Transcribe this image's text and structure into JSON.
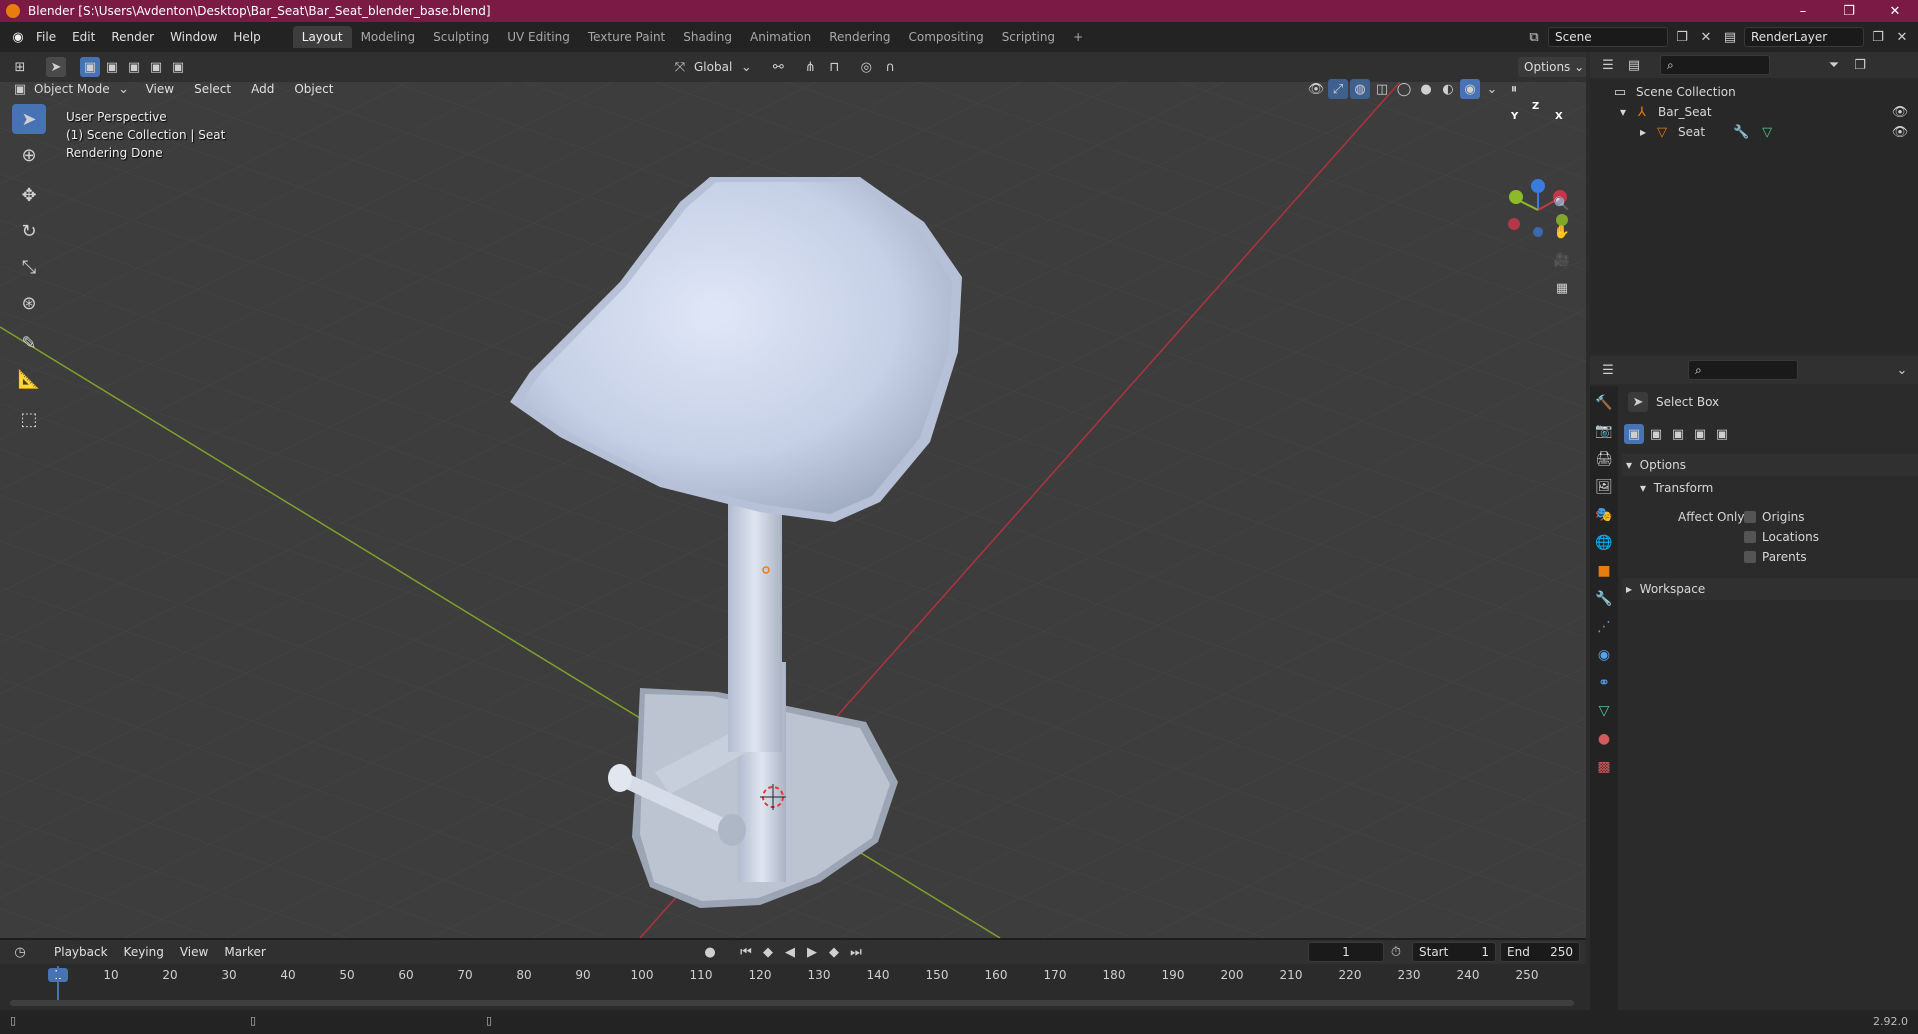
{
  "window": {
    "title": "Blender [S:\\Users\\Avdenton\\Desktop\\Bar_Seat\\Bar_Seat_blender_base.blend]",
    "controls": [
      "–",
      "❐",
      "✕"
    ]
  },
  "menubar": {
    "items": [
      "File",
      "Edit",
      "Render",
      "Window",
      "Help"
    ],
    "workspaces": [
      "Layout",
      "Modeling",
      "Sculpting",
      "UV Editing",
      "Texture Paint",
      "Shading",
      "Animation",
      "Rendering",
      "Compositing",
      "Scripting"
    ],
    "active_workspace": "Layout",
    "add_tab": "+",
    "scene": "Scene",
    "view_layer": "RenderLayer"
  },
  "tool_header": {
    "orientation": "Global",
    "options_label": "Options"
  },
  "viewport_header": {
    "mode": "Object Mode",
    "menus": [
      "View",
      "Select",
      "Add",
      "Object"
    ]
  },
  "viewport": {
    "overlay_lines": [
      "User Perspective",
      "(1) Scene Collection | Seat",
      "Rendering Done"
    ],
    "gizmo": {
      "x": "X",
      "y": "Y",
      "z": "Z"
    }
  },
  "outliner": {
    "root": "Scene Collection",
    "items": [
      {
        "label": "Bar_Seat",
        "depth": 1
      },
      {
        "label": "Seat",
        "depth": 2
      }
    ]
  },
  "properties": {
    "tool_name": "Select Box",
    "sections": {
      "options": "Options",
      "transform": "Transform",
      "affect_only_label": "Affect Only",
      "checkboxes": [
        "Origins",
        "Locations",
        "Parents"
      ],
      "workspace": "Workspace"
    }
  },
  "timeline": {
    "menus": [
      "Playback",
      "Keying",
      "View",
      "Marker"
    ],
    "current_frame": "1",
    "start_label": "Start",
    "start_value": "1",
    "end_label": "End",
    "end_value": "250",
    "ruler": [
      "1",
      "10",
      "20",
      "30",
      "40",
      "50",
      "60",
      "70",
      "80",
      "90",
      "100",
      "110",
      "120",
      "130",
      "140",
      "150",
      "160",
      "170",
      "180",
      "190",
      "200",
      "210",
      "220",
      "230",
      "240",
      "250"
    ]
  },
  "statusbar": {
    "version": "2.92.0"
  },
  "colors": {
    "title_bg": "#7a1a45",
    "accent": "#4772b3",
    "x_axis": "#c6364b",
    "y_axis": "#8cba29",
    "z_axis": "#3a7be0",
    "orange": "#e87d0d"
  }
}
